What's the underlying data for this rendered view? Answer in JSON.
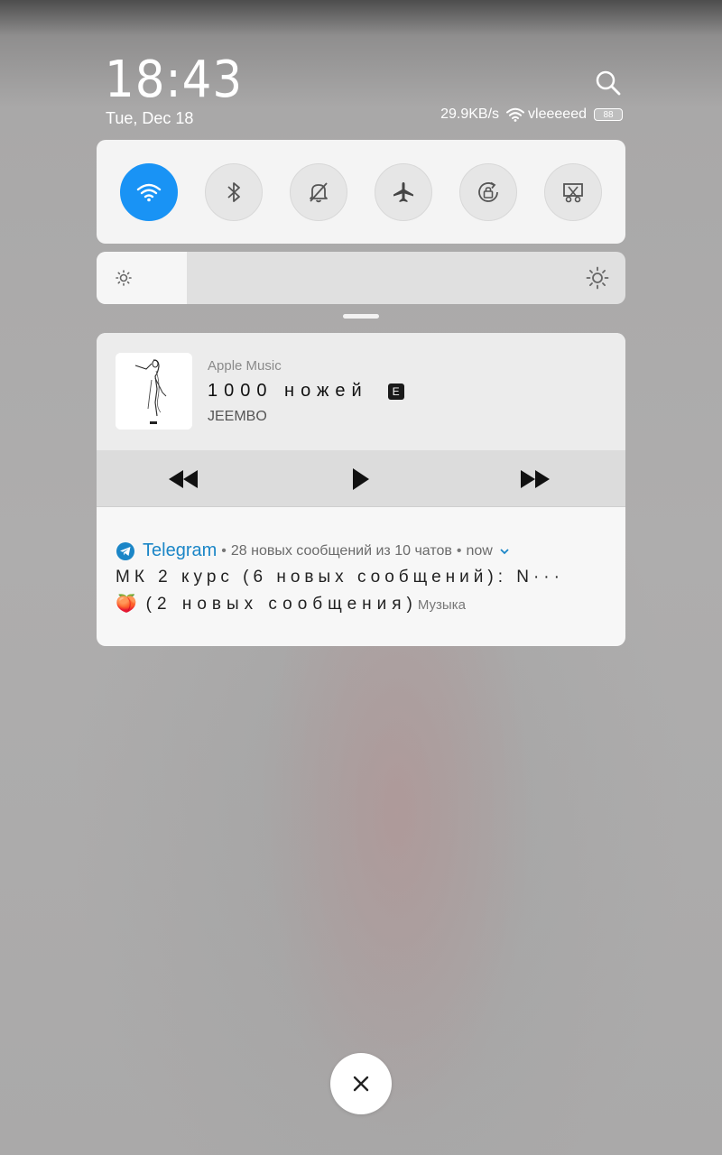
{
  "status": {
    "time": "18:43",
    "date": "Tue, Dec 18",
    "net_speed": "29.9KB/s",
    "wifi_name": "vleeeeed",
    "battery": "88"
  },
  "quick_toggles": [
    {
      "name": "wifi",
      "icon": "wifi-icon",
      "active": true
    },
    {
      "name": "bluetooth",
      "icon": "bluetooth-icon",
      "active": false
    },
    {
      "name": "mute",
      "icon": "bell-off-icon",
      "active": false
    },
    {
      "name": "airplane",
      "icon": "airplane-icon",
      "active": false
    },
    {
      "name": "rotation-lock",
      "icon": "rotation-lock-icon",
      "active": false
    },
    {
      "name": "screenshot",
      "icon": "screenshot-icon",
      "active": false
    }
  ],
  "brightness": {
    "level": 0.17
  },
  "music": {
    "app": "Apple Music",
    "title": "1000 ножей",
    "explicit_badge": "E",
    "artist": "JEEMBO"
  },
  "telegram": {
    "app": "Telegram",
    "summary": "28 новых сообщений из 10 чатов",
    "time": "now",
    "line1": "МК 2 курс (6 новых сообщений): N···",
    "line2_emoji": "🍑",
    "line2": "(2 новых сообщения)",
    "line2_extra": "Музыка"
  },
  "colors": {
    "accent": "#1993f5",
    "telegram": "#1b86c7"
  }
}
